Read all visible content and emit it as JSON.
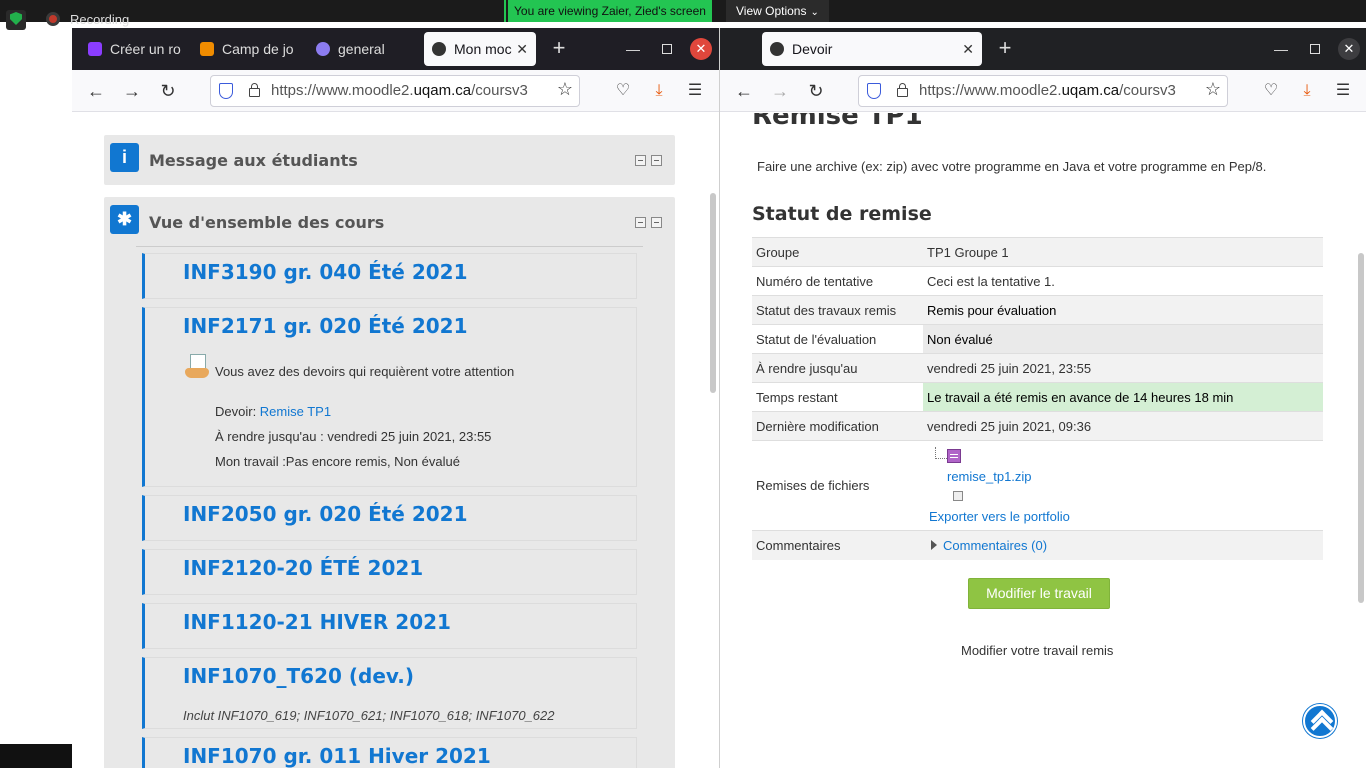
{
  "share_bar": {
    "recording_label": "Recording",
    "viewing_label": "You are viewing Zaier, Zied's screen",
    "view_options_label": "View Options"
  },
  "left_window": {
    "tabs": [
      {
        "label": "Créer un ro",
        "icon": "app-d-icon",
        "color": "#8b3dff"
      },
      {
        "label": "Camp de jo",
        "icon": "camp-icon",
        "color": "#f08c00"
      },
      {
        "label": "general",
        "icon": "discord-icon",
        "color": "#8c7cf0"
      },
      {
        "label": "Mon moc",
        "icon": "moodle-icon",
        "color": "#333333"
      }
    ],
    "url_prefix": "https://www.moodle2.",
    "url_domain": "uqam.ca",
    "url_suffix": "/coursv3",
    "blocks": {
      "message_title": "Message aux étudiants",
      "overview_title": "Vue d'ensemble des cours"
    },
    "courses": [
      {
        "title": "INF3190 gr. 040 Été 2021"
      },
      {
        "title": "INF2171 gr. 020 Été 2021",
        "notice": "Vous avez des devoirs qui requièrent votre attention",
        "assignment_prefix": "Devoir: ",
        "assignment_link": "Remise TP1",
        "due": "À rendre jusqu'au : vendredi 25 juin 2021, 23:55",
        "work": "Mon travail :Pas encore remis, Non évalué"
      },
      {
        "title": "INF2050 gr. 020 Été 2021"
      },
      {
        "title": "INF2120-20 ÉTÉ 2021"
      },
      {
        "title": "INF1120-21 HIVER 2021"
      },
      {
        "title": "INF1070_T620 (dev.)",
        "includes": "Inclut INF1070_619; INF1070_621; INF1070_618; INF1070_622"
      },
      {
        "title": "INF1070 gr. 011 Hiver 2021"
      }
    ]
  },
  "right_window": {
    "tab_label": "Devoir",
    "url_prefix": "https://www.moodle2.",
    "url_domain": "uqam.ca",
    "url_suffix": "/coursv3",
    "page_title": "Remise TP1",
    "intro": "Faire une archive (ex: zip) avec votre programme en Java et votre programme en Pep/8.",
    "status_heading": "Statut de remise",
    "rows": [
      {
        "label": "Groupe",
        "value": "TP1 Groupe 1"
      },
      {
        "label": "Numéro de tentative",
        "value": "Ceci est la tentative 1."
      },
      {
        "label": "Statut des travaux remis",
        "value": "Remis pour évaluation"
      },
      {
        "label": "Statut de l'évaluation",
        "value": "Non évalué"
      },
      {
        "label": "À rendre jusqu'au",
        "value": "vendredi 25 juin 2021, 23:55"
      },
      {
        "label": "Temps restant",
        "value": "Le travail a été remis en avance de 14 heures 18 min"
      },
      {
        "label": "Dernière modification",
        "value": "vendredi 25 juin 2021, 09:36"
      },
      {
        "label": "Remises de fichiers",
        "file": "remise_tp1.zip",
        "export": "Exporter vers le portfolio"
      },
      {
        "label": "Commentaires",
        "value": "Commentaires (0)"
      }
    ],
    "modify_button": "Modifier le travail",
    "modify_text": "Modifier votre travail remis",
    "colors": {
      "accent": "#1177d1",
      "early_bg": "#d4efd4",
      "button_green": "#8fc443"
    }
  }
}
